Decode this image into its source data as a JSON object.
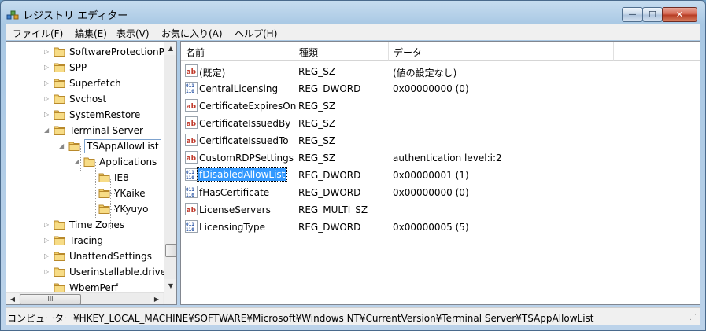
{
  "window": {
    "title": "レジストリ エディター",
    "controls": {
      "minimize": "—",
      "maximize": "☐",
      "close": "✕"
    }
  },
  "menu": [
    "ファイル(F)",
    "編集(E)",
    "表示(V)",
    "お気に入り(A)",
    "ヘルプ(H)"
  ],
  "tree": {
    "items": [
      {
        "label": "SoftwareProtectionP",
        "expander": "▷"
      },
      {
        "label": "SPP",
        "expander": "▷"
      },
      {
        "label": "Superfetch",
        "expander": "▷"
      },
      {
        "label": "Svchost",
        "expander": "▷"
      },
      {
        "label": "SystemRestore",
        "expander": "▷"
      },
      {
        "label": "Terminal Server",
        "expander": "◢"
      },
      {
        "label": "TSAppAllowList",
        "expander": "◢"
      },
      {
        "label": "Applications",
        "expander": "◢"
      },
      {
        "label": "IE8",
        "expander": ""
      },
      {
        "label": "YKaike",
        "expander": ""
      },
      {
        "label": "YKyuyo",
        "expander": ""
      },
      {
        "label": "Time Zones",
        "expander": "▷"
      },
      {
        "label": "Tracing",
        "expander": "▷"
      },
      {
        "label": "UnattendSettings",
        "expander": "▷"
      },
      {
        "label": "Userinstallable.drive",
        "expander": "▷"
      },
      {
        "label": "WbemPerf",
        "expander": ""
      }
    ],
    "scroll": {
      "up": "▲",
      "down": "▼",
      "left": "◀",
      "right": "▶",
      "thumb_grip": "III"
    }
  },
  "list": {
    "columns": [
      "名前",
      "種類",
      "データ"
    ],
    "rows": [
      {
        "icon": "string-value-icon",
        "name": "(既定)",
        "type": "REG_SZ",
        "data": "(値の設定なし)"
      },
      {
        "icon": "binary-value-icon",
        "name": "CentralLicensing",
        "type": "REG_DWORD",
        "data": "0x00000000 (0)"
      },
      {
        "icon": "string-value-icon",
        "name": "CertificateExpiresOn",
        "type": "REG_SZ",
        "data": ""
      },
      {
        "icon": "string-value-icon",
        "name": "CertificateIssuedBy",
        "type": "REG_SZ",
        "data": ""
      },
      {
        "icon": "string-value-icon",
        "name": "CertificateIssuedTo",
        "type": "REG_SZ",
        "data": ""
      },
      {
        "icon": "string-value-icon",
        "name": "CustomRDPSettings",
        "type": "REG_SZ",
        "data": "authentication level:i:2"
      },
      {
        "icon": "binary-value-icon",
        "name": "fDisabledAllowList",
        "type": "REG_DWORD",
        "data": "0x00000001 (1)"
      },
      {
        "icon": "binary-value-icon",
        "name": "fHasCertificate",
        "type": "REG_DWORD",
        "data": "0x00000000 (0)"
      },
      {
        "icon": "string-value-icon",
        "name": "LicenseServers",
        "type": "REG_MULTI_SZ",
        "data": ""
      },
      {
        "icon": "binary-value-icon",
        "name": "LicensingType",
        "type": "REG_DWORD",
        "data": "0x00000005 (5)"
      }
    ]
  },
  "status": {
    "path": "コンピューター¥HKEY_LOCAL_MACHINE¥SOFTWARE¥Microsoft¥Windows NT¥CurrentVersion¥Terminal Server¥TSAppAllowList",
    "grip": "⋰"
  },
  "colors": {
    "selection": "#3399ff",
    "folder": "#e8b94a",
    "ab_icon": "#c0392b",
    "bin_icon": "#2a55a6"
  }
}
